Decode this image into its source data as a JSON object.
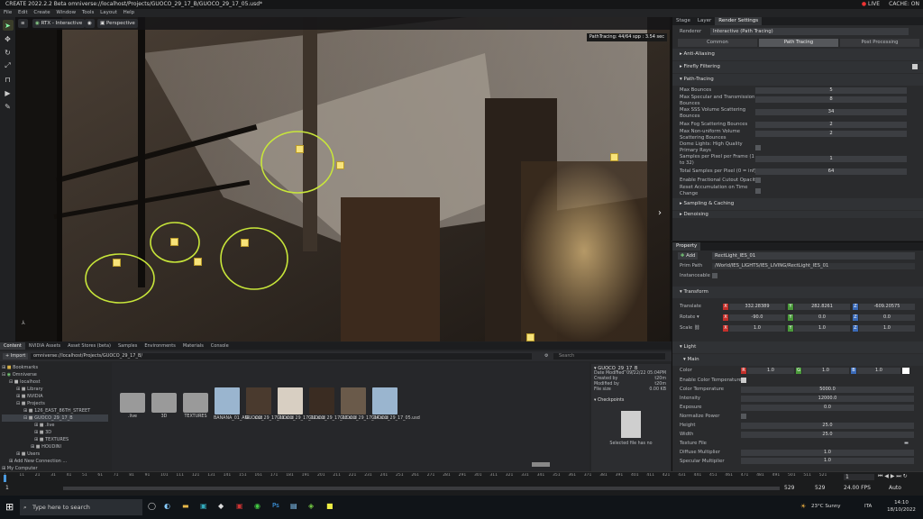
{
  "app": {
    "title": "CREATE  2022.2.2 Beta  omniverse://localhost/Projects/GUOCO_29_17_B/GUOCO_29_17_05.usd*",
    "live": "LIVE",
    "cache": "CACHE: ON"
  },
  "menu": [
    "File",
    "Edit",
    "Create",
    "Window",
    "Tools",
    "Layout",
    "Help"
  ],
  "viewport": {
    "renderer_chip": "RTX - Interactive",
    "camera_chip": "Perspective",
    "pt_badge": "PathTracing: 44/64 spp : 3.54 sec"
  },
  "render_settings": {
    "tabs": [
      "Stage",
      "Layer",
      "Render Settings"
    ],
    "renderer_label": "Renderer",
    "renderer_value": "Interactive (Path Tracing)",
    "subtabs": [
      "Common",
      "Path Tracing",
      "Post Processing"
    ],
    "sections": {
      "aa": "Anti-Aliasing",
      "ff": "Firefly Filtering",
      "pt": "Path-Tracing",
      "sc": "Sampling & Caching",
      "dn": "Denoising"
    },
    "rows": [
      {
        "label": "Max Bounces",
        "value": "5"
      },
      {
        "label": "Max Specular and Transmission Bounces",
        "value": "8"
      },
      {
        "label": "Max SSS Volume Scattering Bounces",
        "value": "34"
      },
      {
        "label": "Max Fog Scattering Bounces",
        "value": "2"
      },
      {
        "label": "Max Non-uniform Volume Scattering Bounces",
        "value": "2"
      },
      {
        "label": "Dome Lights: High Quality Primary Rays",
        "value": ""
      },
      {
        "label": "Samples per Pixel per Frame (1 to 32)",
        "value": "1"
      },
      {
        "label": "Total Samples per Pixel (0 = inf)",
        "value": "64"
      },
      {
        "label": "Enable Fractional Cutout Opacity",
        "value": ""
      },
      {
        "label": "Reset Accumulation on Time Change",
        "value": ""
      }
    ]
  },
  "property": {
    "tab": "Property",
    "add": "Add",
    "name": "RectLight_IES_01",
    "prim_path_label": "Prim Path",
    "prim_path": "/World/IES_LIGHTS/IES_LIVING/RectLight_IES_01",
    "instanceable": "Instanceable",
    "transform": "Transform",
    "translate_label": "Translate",
    "translate": [
      "332.28389",
      "282.8261",
      "-609.20575"
    ],
    "rotate_label": "Rotate",
    "rotate": [
      "-90.0",
      "0.0",
      "0.0"
    ],
    "scale_label": "Scale",
    "scale": [
      "1.0",
      "1.0",
      "1.0"
    ],
    "light": "Light",
    "main": "Main",
    "color_label": "Color",
    "color": [
      "1.0",
      "1.0",
      "1.0"
    ],
    "light_rows": [
      {
        "label": "Enable Color Temperature",
        "value": ""
      },
      {
        "label": "Color Temperature",
        "value": "5000.0"
      },
      {
        "label": "Intensity",
        "value": "12000.0"
      },
      {
        "label": "Exposure",
        "value": "0.0"
      },
      {
        "label": "Normalize Power",
        "value": ""
      },
      {
        "label": "Height",
        "value": "25.0"
      },
      {
        "label": "Width",
        "value": "25.0"
      },
      {
        "label": "Texture File",
        "value": ""
      },
      {
        "label": "Diffuse Multiplier",
        "value": "1.0"
      },
      {
        "label": "Specular Multiplier",
        "value": "1.0"
      }
    ]
  },
  "content": {
    "tabs": [
      "Content",
      "NVIDIA Assets",
      "Asset Stores (beta)",
      "Samples",
      "Environments",
      "Materials",
      "Console"
    ],
    "import": "Import",
    "path": "omniverse://localhost/Projects/GUOCO_29_17_B/",
    "search": "Search",
    "tree": [
      "Bookmarks",
      "Omniverse",
      "localhost",
      "Library",
      "NVIDIA",
      "Projects",
      "126_EAST_86TH_STREET",
      "GUOCO_29_17_B",
      ".live",
      "3D",
      "TEXTURES",
      "HOUDINI",
      "Users",
      "Add New Connection ...",
      "My Computer"
    ],
    "files": [
      ".live",
      "3D",
      "TEXTURES",
      "BANANA_01_ANI....usd",
      "GUOCO_29_17_01.usd",
      "GUOCO_29_17_02.usd",
      "GUOCO_29_17_03.usd",
      "GUOCO_29_17_04.usd",
      "GUOCO_29_17_05.usd"
    ],
    "info": {
      "name": "GUOCO_29_17_B",
      "date_label": "Date Modified",
      "date": "09/22/22 05:04PM",
      "created_label": "Created by",
      "created": "t20m",
      "modified_label": "Modified by",
      "modified": "t20m",
      "size_label": "File size",
      "size": "0.00 KB",
      "checkpoints": "Checkpoints",
      "no_cp": "Selected file has no"
    }
  },
  "timeline": {
    "start": "1",
    "end": "529",
    "end2": "529",
    "current": "1",
    "fps": "24.00 FPS",
    "auto": "Auto",
    "ticks": [
      "1",
      "11",
      "21",
      "31",
      "41",
      "51",
      "61",
      "71",
      "81",
      "91",
      "101",
      "111",
      "121",
      "131",
      "141",
      "151",
      "161",
      "171",
      "181",
      "191",
      "201",
      "211",
      "221",
      "231",
      "241",
      "251",
      "261",
      "271",
      "281",
      "291",
      "301",
      "311",
      "321",
      "331",
      "341",
      "351",
      "361",
      "371",
      "381",
      "391",
      "401",
      "411",
      "421",
      "431",
      "441",
      "451",
      "461",
      "471",
      "481",
      "491",
      "501",
      "511",
      "521"
    ]
  },
  "taskbar": {
    "search": "Type here to search",
    "weather": "23°C  Sunny",
    "lang": "ITA",
    "time": "14:10",
    "date": "18/10/2022"
  },
  "colors": {
    "accent": "#c8e63a",
    "x": "#c4302b",
    "y": "#4a9a3a",
    "z": "#3a6ab8"
  }
}
